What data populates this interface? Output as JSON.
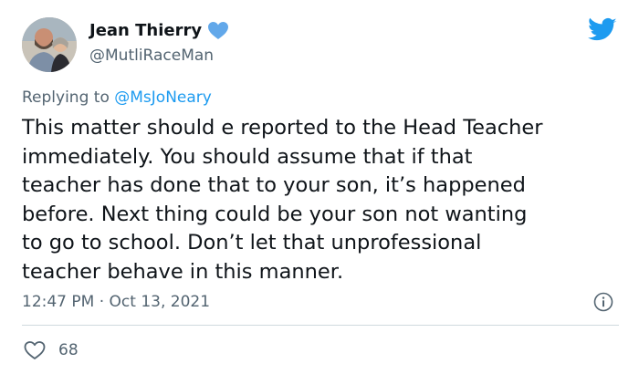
{
  "author": {
    "display_name": "Jean Thierry",
    "handle": "@MutliRaceMan",
    "avatar_icon": "profile-photo",
    "verified_icon": "verified-heart-icon"
  },
  "reply_context": {
    "prefix": "Replying to ",
    "mention": "@MsJoNeary"
  },
  "tweet": {
    "text": "This matter should e reported to the Head Teacher\nimmediately. You should assume that if that\nteacher has done that to your son, it’s happened\nbefore. Next thing could be your son not wanting\nto go to school. Don’t let that unprofessional\nteacher behave in this manner.",
    "timestamp": "12:47 PM · Oct 13, 2021"
  },
  "engagement": {
    "likes": "68"
  },
  "colors": {
    "brand_blue": "#1d9bf0",
    "text_primary": "#0f1419",
    "text_secondary": "#536471",
    "verified_heart": "#62a8ea",
    "divider": "#cfd9de"
  },
  "icons": {
    "brand": "twitter-bird-icon",
    "info": "info-icon",
    "like": "heart-icon"
  }
}
